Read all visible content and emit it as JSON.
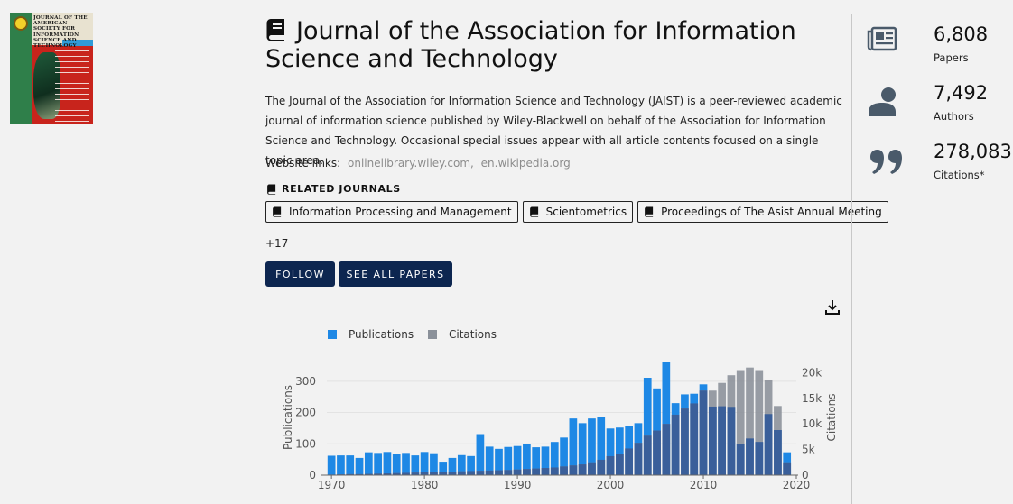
{
  "cover": {
    "lines": [
      "JOURNAL OF THE",
      "AMERICAN",
      "SOCIETY FOR",
      "INFORMATION",
      "SCIENCE AND",
      "TECHNOLOGY"
    ]
  },
  "journal": {
    "title": "Journal of the Association for Information Science and Technology",
    "description": "The Journal of the Association for Information Science and Technology (JAIST) is a peer-reviewed academic journal of information science published by Wiley-Blackwell on behalf of the Association for Information Science and Technology. Occasional special issues appear with all article contents focused on a single topic area.",
    "website_label": "Website links:",
    "links": [
      "onlinelibrary.wiley.com,",
      "en.wikipedia.org"
    ]
  },
  "related": {
    "heading": "RELATED JOURNALS",
    "items": [
      "Information Processing and Management",
      "Scientometrics",
      "Proceedings of The Asist Annual Meeting"
    ],
    "more": "+17"
  },
  "actions": {
    "follow": "FOLLOW",
    "see_all": "SEE ALL PAPERS"
  },
  "stats": [
    {
      "value": "6,808",
      "label": "Papers",
      "icon": "newspaper-icon"
    },
    {
      "value": "7,492",
      "label": "Authors",
      "icon": "person-icon"
    },
    {
      "value": "278,083",
      "label": "Citations*",
      "icon": "quote-icon"
    }
  ],
  "colors": {
    "publications": "#1e88e5",
    "citations": "#8a9099",
    "overlap": "#3a5f9a",
    "button": "#0d2650"
  },
  "chart_data": {
    "type": "bar",
    "legend": [
      "Publications",
      "Citations"
    ],
    "legend_position": "top-left",
    "y_left_label": "Publications",
    "y_right_label": "Citations",
    "y_left_ticks": [
      "0",
      "100",
      "200",
      "300"
    ],
    "y_right_ticks": [
      "0",
      "5k",
      "10k",
      "15k",
      "20k"
    ],
    "x_ticks": [
      "1970",
      "1980",
      "1990",
      "2000",
      "2010",
      "2020"
    ],
    "ylim_left": [
      0,
      360
    ],
    "ylim_right": [
      0,
      22000
    ],
    "years": [
      1970,
      1971,
      1972,
      1973,
      1974,
      1975,
      1976,
      1977,
      1978,
      1979,
      1980,
      1981,
      1982,
      1983,
      1984,
      1985,
      1986,
      1987,
      1988,
      1989,
      1990,
      1991,
      1992,
      1993,
      1994,
      1995,
      1996,
      1997,
      1998,
      1999,
      2000,
      2001,
      2002,
      2003,
      2004,
      2005,
      2006,
      2007,
      2008,
      2009,
      2010,
      2011,
      2012,
      2013,
      2014,
      2015,
      2016,
      2017,
      2018,
      2019
    ],
    "publications": [
      62,
      63,
      63,
      55,
      73,
      71,
      74,
      67,
      71,
      63,
      74,
      70,
      43,
      55,
      64,
      61,
      131,
      91,
      84,
      90,
      93,
      100,
      89,
      91,
      106,
      120,
      181,
      166,
      181,
      186,
      149,
      152,
      158,
      166,
      311,
      277,
      360,
      230,
      258,
      260,
      290,
      219,
      220,
      218,
      98,
      117,
      106,
      195,
      144,
      73
    ],
    "citations": [
      100,
      150,
      200,
      200,
      250,
      300,
      350,
      400,
      450,
      500,
      550,
      600,
      650,
      700,
      750,
      800,
      850,
      900,
      950,
      1000,
      1100,
      1200,
      1300,
      1400,
      1500,
      1700,
      1900,
      2100,
      2500,
      3000,
      3700,
      4200,
      5200,
      6300,
      7700,
      8700,
      10000,
      11800,
      13000,
      14000,
      16500,
      16500,
      18000,
      19500,
      20500,
      21000,
      20500,
      18500,
      13500,
      2500
    ]
  }
}
